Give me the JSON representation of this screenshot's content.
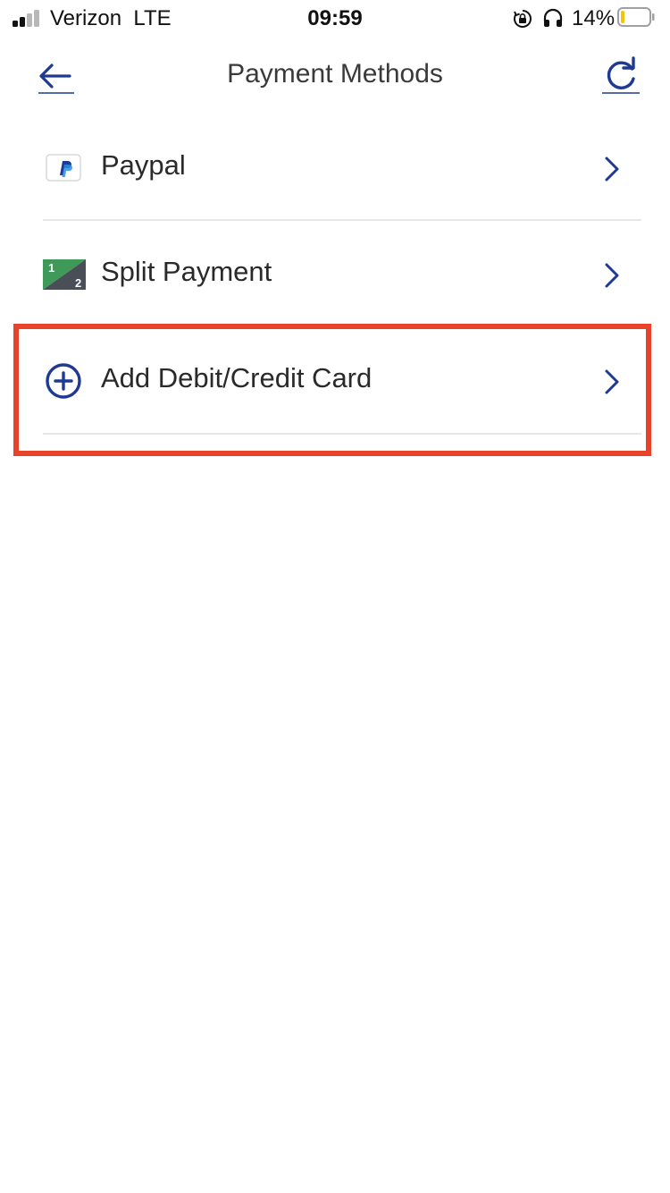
{
  "status_bar": {
    "carrier": "Verizon  LTE",
    "time": "09:59",
    "battery_percent": "14%",
    "battery_level": 0.14,
    "signal_bars_active": 2,
    "signal_bars_total": 4,
    "icons": [
      "signal-icon",
      "rotation-lock-icon",
      "headphones-icon",
      "battery-icon"
    ]
  },
  "nav": {
    "title": "Payment Methods",
    "back_icon": "arrow-left-icon",
    "refresh_icon": "refresh-icon"
  },
  "payment_methods": [
    {
      "id": "paypal",
      "label": "Paypal",
      "icon": "paypal-icon"
    },
    {
      "id": "split",
      "label": "Split Payment",
      "icon": "split-payment-icon"
    },
    {
      "id": "add-card",
      "label": "Add Debit/Credit Card",
      "icon": "plus-circle-icon"
    }
  ],
  "colors": {
    "accent": "#1f3a93",
    "highlight": "#e8432a",
    "split_green": "#3f9a5a",
    "split_gray": "#4a4f57",
    "battery_low": "#f2c500"
  }
}
